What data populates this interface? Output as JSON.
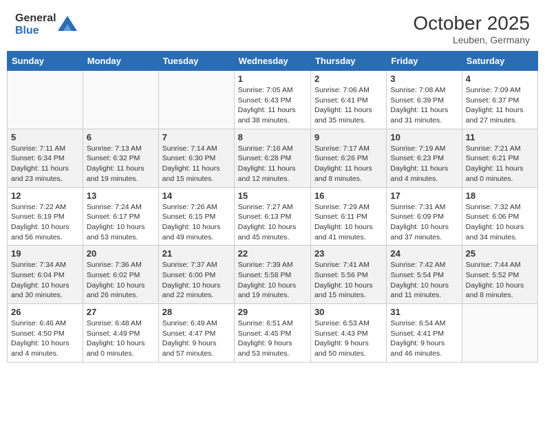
{
  "header": {
    "logo_general": "General",
    "logo_blue": "Blue",
    "month": "October 2025",
    "location": "Leuben, Germany"
  },
  "weekdays": [
    "Sunday",
    "Monday",
    "Tuesday",
    "Wednesday",
    "Thursday",
    "Friday",
    "Saturday"
  ],
  "weeks": [
    [
      {
        "day": "",
        "info": ""
      },
      {
        "day": "",
        "info": ""
      },
      {
        "day": "",
        "info": ""
      },
      {
        "day": "1",
        "info": "Sunrise: 7:05 AM\nSunset: 6:43 PM\nDaylight: 11 hours\nand 38 minutes."
      },
      {
        "day": "2",
        "info": "Sunrise: 7:06 AM\nSunset: 6:41 PM\nDaylight: 11 hours\nand 35 minutes."
      },
      {
        "day": "3",
        "info": "Sunrise: 7:08 AM\nSunset: 6:39 PM\nDaylight: 11 hours\nand 31 minutes."
      },
      {
        "day": "4",
        "info": "Sunrise: 7:09 AM\nSunset: 6:37 PM\nDaylight: 11 hours\nand 27 minutes."
      }
    ],
    [
      {
        "day": "5",
        "info": "Sunrise: 7:11 AM\nSunset: 6:34 PM\nDaylight: 11 hours\nand 23 minutes."
      },
      {
        "day": "6",
        "info": "Sunrise: 7:13 AM\nSunset: 6:32 PM\nDaylight: 11 hours\nand 19 minutes."
      },
      {
        "day": "7",
        "info": "Sunrise: 7:14 AM\nSunset: 6:30 PM\nDaylight: 11 hours\nand 15 minutes."
      },
      {
        "day": "8",
        "info": "Sunrise: 7:16 AM\nSunset: 6:28 PM\nDaylight: 11 hours\nand 12 minutes."
      },
      {
        "day": "9",
        "info": "Sunrise: 7:17 AM\nSunset: 6:26 PM\nDaylight: 11 hours\nand 8 minutes."
      },
      {
        "day": "10",
        "info": "Sunrise: 7:19 AM\nSunset: 6:23 PM\nDaylight: 11 hours\nand 4 minutes."
      },
      {
        "day": "11",
        "info": "Sunrise: 7:21 AM\nSunset: 6:21 PM\nDaylight: 11 hours\nand 0 minutes."
      }
    ],
    [
      {
        "day": "12",
        "info": "Sunrise: 7:22 AM\nSunset: 6:19 PM\nDaylight: 10 hours\nand 56 minutes."
      },
      {
        "day": "13",
        "info": "Sunrise: 7:24 AM\nSunset: 6:17 PM\nDaylight: 10 hours\nand 53 minutes."
      },
      {
        "day": "14",
        "info": "Sunrise: 7:26 AM\nSunset: 6:15 PM\nDaylight: 10 hours\nand 49 minutes."
      },
      {
        "day": "15",
        "info": "Sunrise: 7:27 AM\nSunset: 6:13 PM\nDaylight: 10 hours\nand 45 minutes."
      },
      {
        "day": "16",
        "info": "Sunrise: 7:29 AM\nSunset: 6:11 PM\nDaylight: 10 hours\nand 41 minutes."
      },
      {
        "day": "17",
        "info": "Sunrise: 7:31 AM\nSunset: 6:09 PM\nDaylight: 10 hours\nand 37 minutes."
      },
      {
        "day": "18",
        "info": "Sunrise: 7:32 AM\nSunset: 6:06 PM\nDaylight: 10 hours\nand 34 minutes."
      }
    ],
    [
      {
        "day": "19",
        "info": "Sunrise: 7:34 AM\nSunset: 6:04 PM\nDaylight: 10 hours\nand 30 minutes."
      },
      {
        "day": "20",
        "info": "Sunrise: 7:36 AM\nSunset: 6:02 PM\nDaylight: 10 hours\nand 26 minutes."
      },
      {
        "day": "21",
        "info": "Sunrise: 7:37 AM\nSunset: 6:00 PM\nDaylight: 10 hours\nand 22 minutes."
      },
      {
        "day": "22",
        "info": "Sunrise: 7:39 AM\nSunset: 5:58 PM\nDaylight: 10 hours\nand 19 minutes."
      },
      {
        "day": "23",
        "info": "Sunrise: 7:41 AM\nSunset: 5:56 PM\nDaylight: 10 hours\nand 15 minutes."
      },
      {
        "day": "24",
        "info": "Sunrise: 7:42 AM\nSunset: 5:54 PM\nDaylight: 10 hours\nand 11 minutes."
      },
      {
        "day": "25",
        "info": "Sunrise: 7:44 AM\nSunset: 5:52 PM\nDaylight: 10 hours\nand 8 minutes."
      }
    ],
    [
      {
        "day": "26",
        "info": "Sunrise: 6:46 AM\nSunset: 4:50 PM\nDaylight: 10 hours\nand 4 minutes."
      },
      {
        "day": "27",
        "info": "Sunrise: 6:48 AM\nSunset: 4:49 PM\nDaylight: 10 hours\nand 0 minutes."
      },
      {
        "day": "28",
        "info": "Sunrise: 6:49 AM\nSunset: 4:47 PM\nDaylight: 9 hours\nand 57 minutes."
      },
      {
        "day": "29",
        "info": "Sunrise: 6:51 AM\nSunset: 4:45 PM\nDaylight: 9 hours\nand 53 minutes."
      },
      {
        "day": "30",
        "info": "Sunrise: 6:53 AM\nSunset: 4:43 PM\nDaylight: 9 hours\nand 50 minutes."
      },
      {
        "day": "31",
        "info": "Sunrise: 6:54 AM\nSunset: 4:41 PM\nDaylight: 9 hours\nand 46 minutes."
      },
      {
        "day": "",
        "info": ""
      }
    ]
  ]
}
